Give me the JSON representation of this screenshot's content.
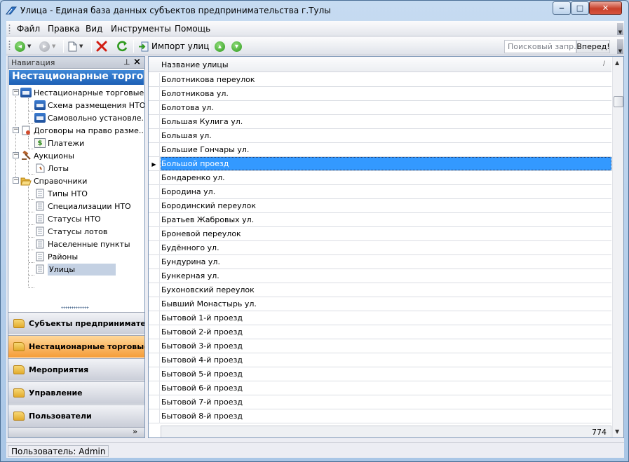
{
  "window": {
    "title": "Улица - Единая база данных субъектов предпринимательства г.Тулы"
  },
  "menu": {
    "file": "Файл",
    "edit": "Правка",
    "view": "Вид",
    "tools": "Инструменты",
    "help": "Помощь"
  },
  "toolbar": {
    "import_label": "Импорт улиц",
    "search_placeholder": "Поисковый запр...",
    "search_button": "Вперед!"
  },
  "navigation": {
    "caption": "Навигация",
    "header": "Нестационарные торго",
    "tree": [
      {
        "label": "Нестационарные торговые...",
        "icon": "store-icon"
      },
      {
        "label": "Схема размещения НТО",
        "icon": "store-icon"
      },
      {
        "label": "Самовольно установле...",
        "icon": "store-icon"
      },
      {
        "label": "Договоры на право разме...",
        "icon": "contract-icon"
      },
      {
        "label": "Платежи",
        "icon": "payment-icon"
      },
      {
        "label": "Аукционы",
        "icon": "gavel-icon"
      },
      {
        "label": "Лоты",
        "icon": "lot-icon"
      },
      {
        "label": "Справочники",
        "icon": "folder-open-icon"
      },
      {
        "label": "Типы НТО",
        "icon": "document-icon"
      },
      {
        "label": "Специализации НТО",
        "icon": "document-icon"
      },
      {
        "label": "Статусы НТО",
        "icon": "document-icon"
      },
      {
        "label": "Статусы лотов",
        "icon": "document-icon"
      },
      {
        "label": "Населенные пункты",
        "icon": "document-icon"
      },
      {
        "label": "Районы",
        "icon": "document-icon"
      },
      {
        "label": "Улицы",
        "icon": "document-icon",
        "selected": true
      }
    ],
    "sections": [
      {
        "label": "Субъекты предпринимател"
      },
      {
        "label": "Нестационарные торговые",
        "active": true
      },
      {
        "label": "Мероприятия"
      },
      {
        "label": "Управление"
      },
      {
        "label": "Пользователи"
      }
    ]
  },
  "grid": {
    "column_header": "Название улицы",
    "rows": [
      "Болотникова переулок",
      "Болотникова ул.",
      "Болотова ул.",
      "Большая Кулига ул.",
      "Большая ул.",
      "Большие Гончары ул.",
      "Большой проезд",
      "Бондаренко ул.",
      "Бородина ул.",
      "Бородинский переулок",
      "Братьев Жабровых ул.",
      "Броневой переулок",
      "Будённого ул.",
      "Бундурина ул.",
      "Бункерная ул.",
      "Бухоновский переулок",
      "Бывший Монастырь ул.",
      "Бытовой 1-й проезд",
      "Бытовой 2-й проезд",
      "Бытовой 3-й проезд",
      "Бытовой 4-й проезд",
      "Бытовой 5-й проезд",
      "Бытовой 6-й проезд",
      "Бытовой 7-й проезд",
      "Бытовой 8-й проезд"
    ],
    "selected_row": "Большой проезд",
    "total_count": "774"
  },
  "status": {
    "user": "Пользователь: Admin"
  },
  "colors": {
    "selection": "#3399ff",
    "nav_header": "#1d5fb5",
    "active_section": "#f59c37",
    "close_button": "#c8402b"
  }
}
